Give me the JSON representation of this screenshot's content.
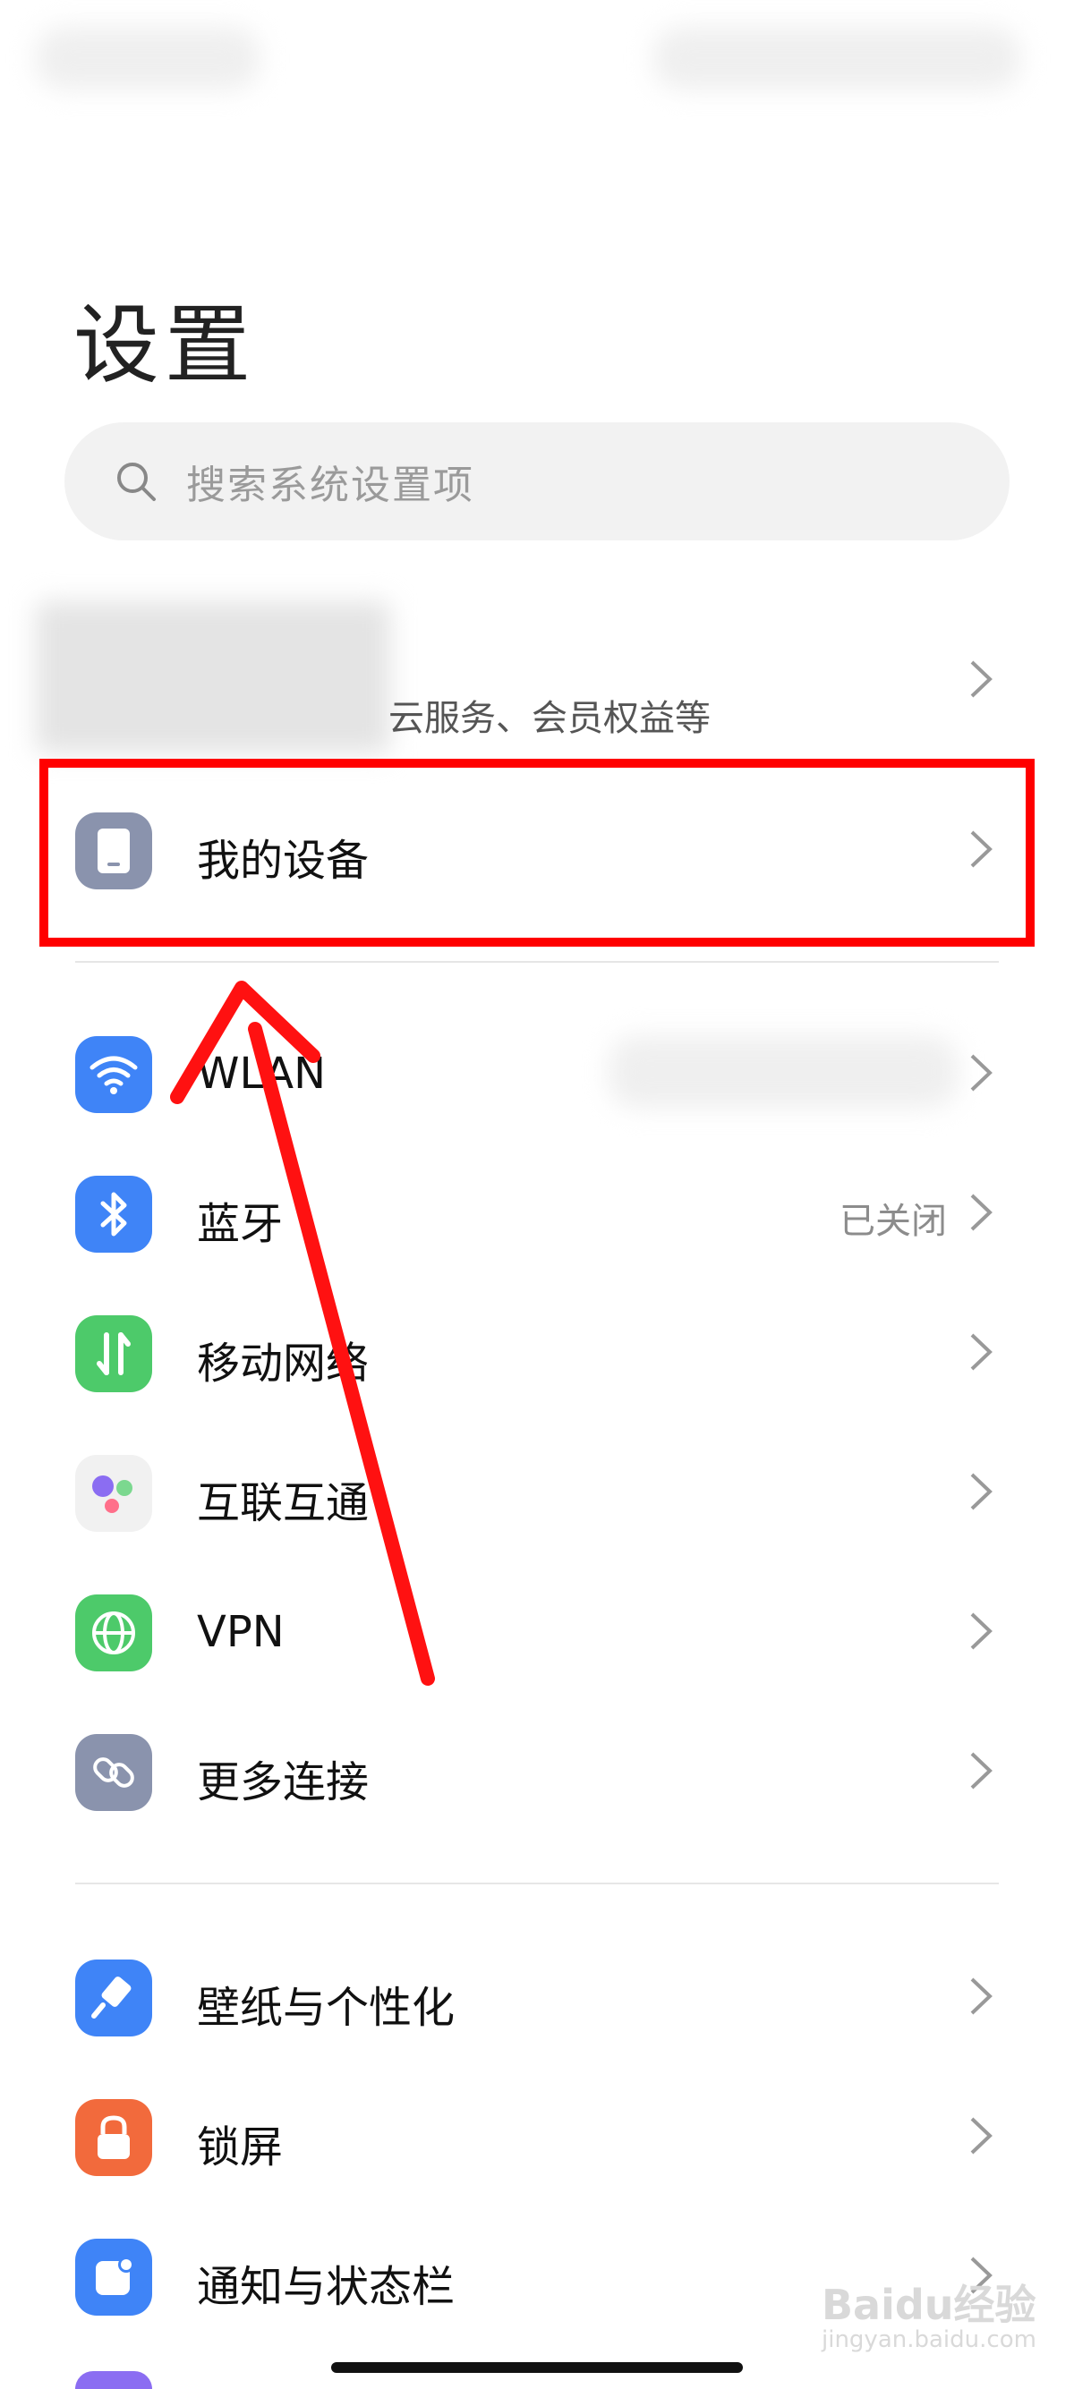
{
  "header": {
    "title": "设置"
  },
  "search": {
    "placeholder": "搜索系统设置项"
  },
  "account": {
    "subtitle": "云服务、会员权益等"
  },
  "my_device": {
    "label": "我的设备"
  },
  "connectivity": [
    {
      "label": "WLAN",
      "value": "",
      "icon": "wifi-icon",
      "color": "#3f84f7"
    },
    {
      "label": "蓝牙",
      "value": "已关闭",
      "icon": "bluetooth-icon",
      "color": "#3f84f7"
    },
    {
      "label": "移动网络",
      "value": "",
      "icon": "mobile-data-icon",
      "color": "#4dca6a"
    },
    {
      "label": "互联互通",
      "value": "",
      "icon": "interconnect-icon",
      "color": "#f1f1f1"
    },
    {
      "label": "VPN",
      "value": "",
      "icon": "globe-icon",
      "color": "#4dca6a"
    },
    {
      "label": "更多连接",
      "value": "",
      "icon": "link-icon",
      "color": "#8a93ad"
    }
  ],
  "personal": [
    {
      "label": "壁纸与个性化",
      "icon": "brush-icon",
      "color": "#3f84f7"
    },
    {
      "label": "锁屏",
      "icon": "lock-icon",
      "color": "#f26a3c"
    },
    {
      "label": "通知与状态栏",
      "icon": "notification-icon",
      "color": "#3f84f7"
    }
  ],
  "watermark": {
    "brand": "Baidu经验",
    "domain": "jingyan.baidu.com"
  }
}
